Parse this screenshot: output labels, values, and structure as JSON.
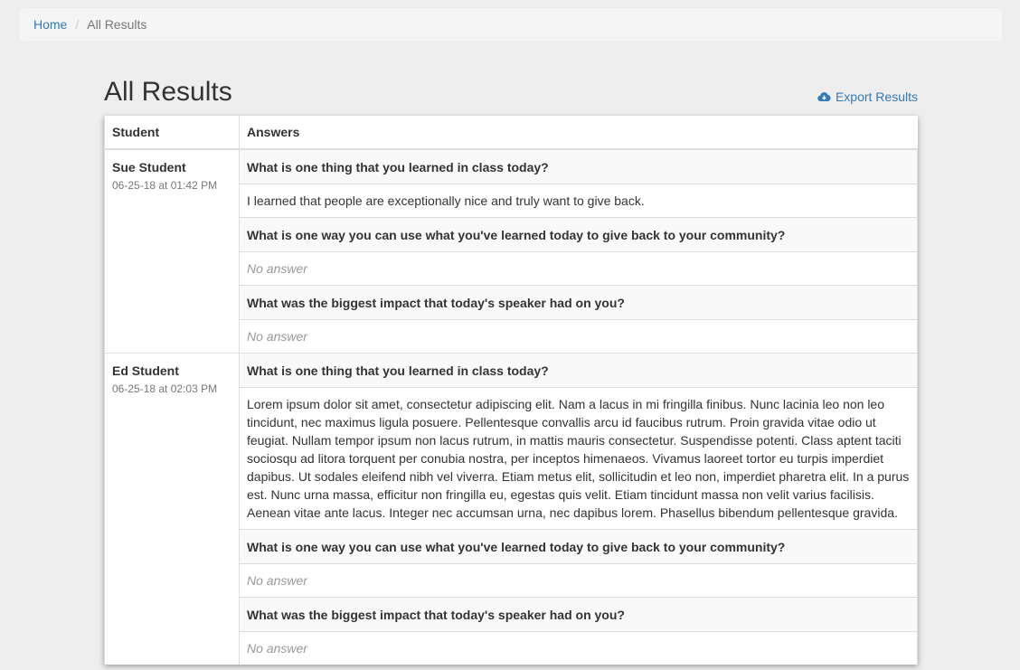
{
  "breadcrumb": {
    "home": "Home",
    "separator": "/",
    "current": "All Results"
  },
  "page": {
    "title": "All Results",
    "export_label": "Export Results",
    "export_icon": "cloud-download-icon",
    "accent_color": "#337ab7"
  },
  "table": {
    "headers": {
      "student": "Student",
      "answers": "Answers"
    },
    "rows": [
      {
        "student": "Sue Student",
        "date": "06-25-18 at 01:42 PM",
        "qa": [
          {
            "question": "What is one thing that you learned in class today?",
            "answer": "I learned that people are exceptionally nice and truly want to give back."
          },
          {
            "question": "What is one way you can use what you've learned today to give back to your community?",
            "answer": "No answer"
          },
          {
            "question": "What was the biggest impact that today's speaker had on you?",
            "answer": "No answer"
          }
        ]
      },
      {
        "student": "Ed Student",
        "date": "06-25-18 at 02:03 PM",
        "qa": [
          {
            "question": "What is one thing that you learned in class today?",
            "answer": "Lorem ipsum dolor sit amet, consectetur adipiscing elit. Nam a lacus in mi fringilla finibus. Nunc lacinia leo non leo tincidunt, nec maximus ligula posuere. Pellentesque convallis arcu id faucibus rutrum. Proin gravida vitae odio ut feugiat. Nullam tempor ipsum non lacus rutrum, in mattis mauris consectetur. Suspendisse potenti. Class aptent taciti sociosqu ad litora torquent per conubia nostra, per inceptos himenaeos. Vivamus laoreet tortor eu turpis imperdiet dapibus. Ut sodales eleifend nibh vel viverra. Etiam metus elit, sollicitudin et leo non, imperdiet pharetra elit. In a purus est. Nunc urna massa, efficitur non fringilla eu, egestas quis velit. Etiam tincidunt massa non velit varius facilisis. Aenean vitae ante lacus. Integer nec accumsan urna, nec dapibus lorem. Phasellus bibendum pellentesque gravida."
          },
          {
            "question": "What is one way you can use what you've learned today to give back to your community?",
            "answer": "No answer"
          },
          {
            "question": "What was the biggest impact that today's speaker had on you?",
            "answer": "No answer"
          }
        ]
      }
    ]
  }
}
